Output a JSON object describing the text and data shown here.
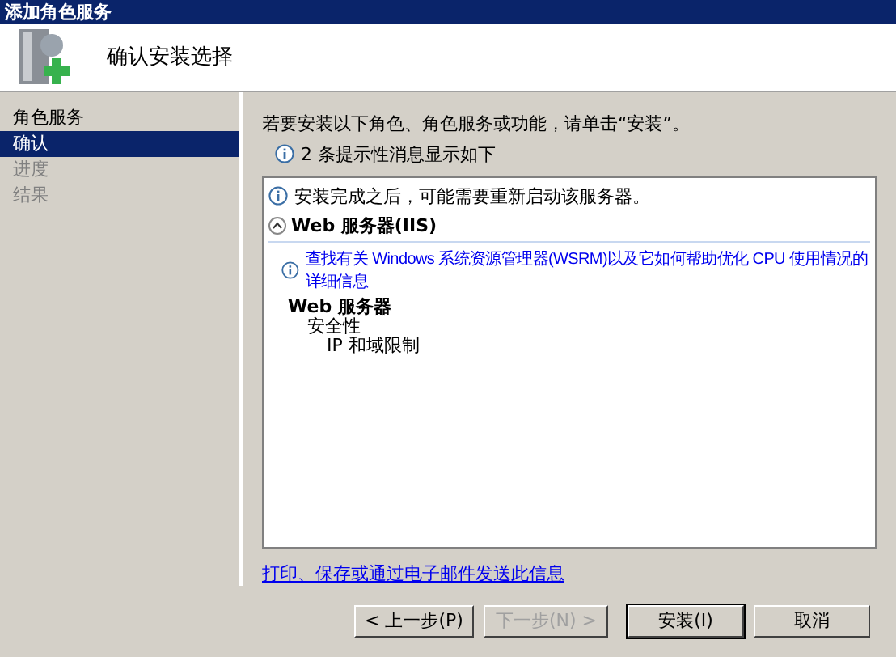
{
  "window": {
    "title": "添加角色服务"
  },
  "header": {
    "title": "确认安装选择"
  },
  "sidebar": {
    "items": [
      {
        "label": "角色服务",
        "selected": false,
        "disabled": false
      },
      {
        "label": "确认",
        "selected": true,
        "disabled": false
      },
      {
        "label": "进度",
        "selected": false,
        "disabled": true
      },
      {
        "label": "结果",
        "selected": false,
        "disabled": true
      }
    ]
  },
  "content": {
    "instruction": "若要安装以下角色、角色服务或功能，请单击“安装”。",
    "notice": "2 条提示性消息显示如下",
    "list": {
      "message": "安装完成之后，可能需要重新启动该服务器。",
      "section": {
        "title": "Web 服务器(IIS)",
        "expanded": true,
        "link": "查找有关 Windows 系统资源管理器(WSRM)以及它如何帮助优化 CPU 使用情况的详细信息",
        "tree": [
          {
            "label": "Web 服务器",
            "children": [
              {
                "label": "安全性",
                "children": [
                  {
                    "label": "IP 和域限制"
                  }
                ]
              }
            ]
          }
        ]
      }
    },
    "footer_link": "打印、保存或通过电子邮件发送此信息"
  },
  "buttons": [
    {
      "label": "< 上一步(P)",
      "disabled": false,
      "default": false
    },
    {
      "label": "下一步(N) >",
      "disabled": true,
      "default": false
    },
    {
      "label": "安装(I)",
      "disabled": false,
      "default": true
    },
    {
      "label": "取消",
      "disabled": false,
      "default": false
    }
  ]
}
